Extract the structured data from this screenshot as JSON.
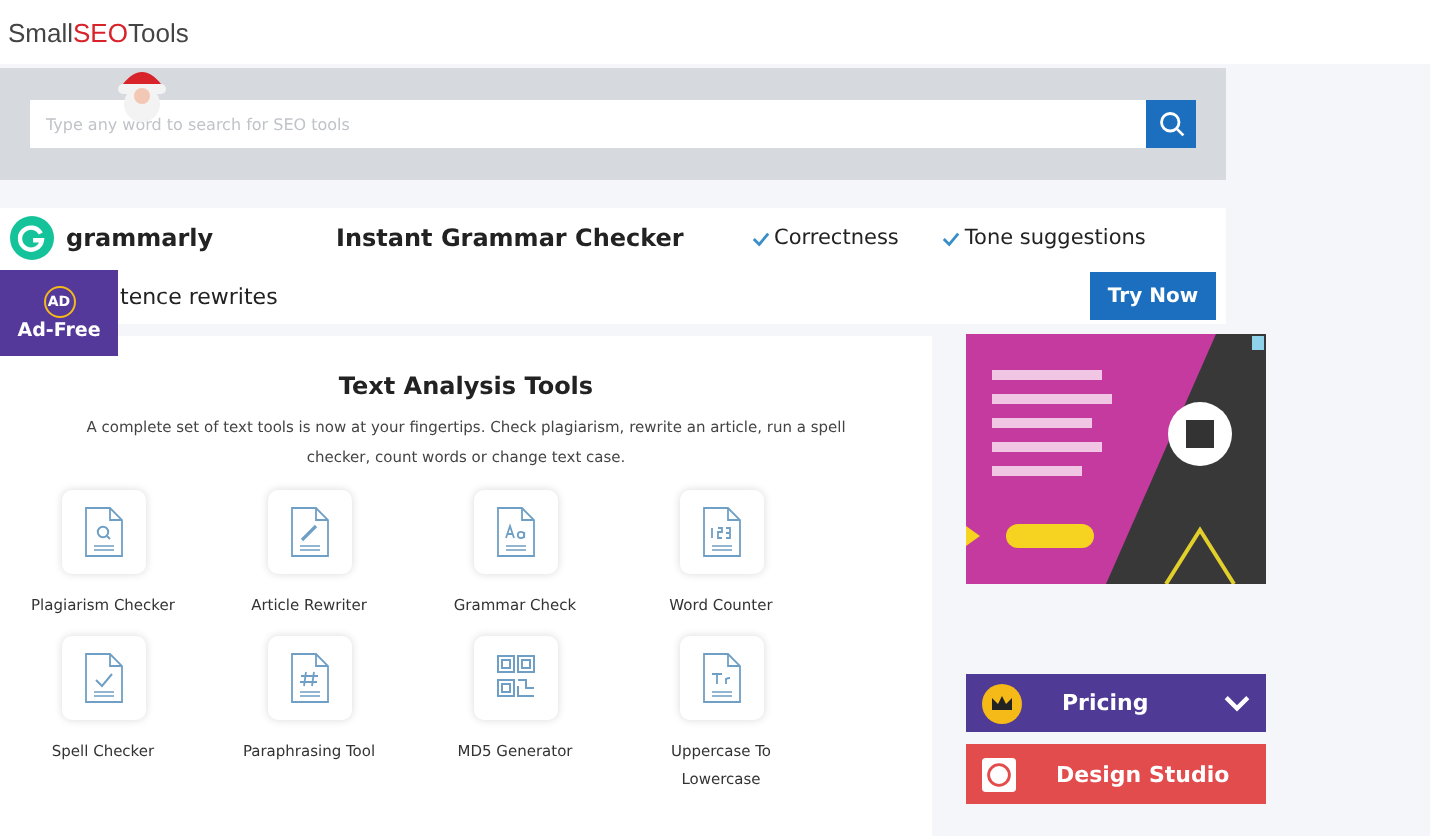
{
  "header": {
    "logo_parts": [
      "Small",
      "SEO",
      "Tools"
    ]
  },
  "search": {
    "placeholder": "Type any word to search for SEO tools"
  },
  "promo": {
    "brand": "grammarly",
    "headline": "Instant Grammar Checker",
    "features": [
      "Correctness",
      "Tone suggestions"
    ],
    "second_line": "tence rewrites",
    "button": "Try Now"
  },
  "ad_free": {
    "label": "Ad-Free",
    "icon_text": "AD"
  },
  "section": {
    "title": "Text Analysis Tools",
    "description": "A complete set of text tools is now at your fingertips. Check plagiarism, rewrite an article, run a spell checker, count words or change text case.",
    "tools": [
      {
        "label": "Plagiarism Checker",
        "kind": "search"
      },
      {
        "label": "Article Rewriter",
        "kind": "pencil"
      },
      {
        "label": "Grammar Check",
        "kind": "letters"
      },
      {
        "label": "Word Counter",
        "kind": "numbers"
      },
      {
        "label": "Spell Checker",
        "kind": "check"
      },
      {
        "label": "Paraphrasing Tool",
        "kind": "hash"
      },
      {
        "label": "MD5 Generator",
        "kind": "qr"
      },
      {
        "label": "Uppercase To Lowercase",
        "kind": "case"
      }
    ]
  },
  "sidebar": {
    "menu": [
      {
        "label": "Pricing",
        "kind": "pricing"
      },
      {
        "label": "Design Studio",
        "kind": "studio"
      }
    ]
  }
}
